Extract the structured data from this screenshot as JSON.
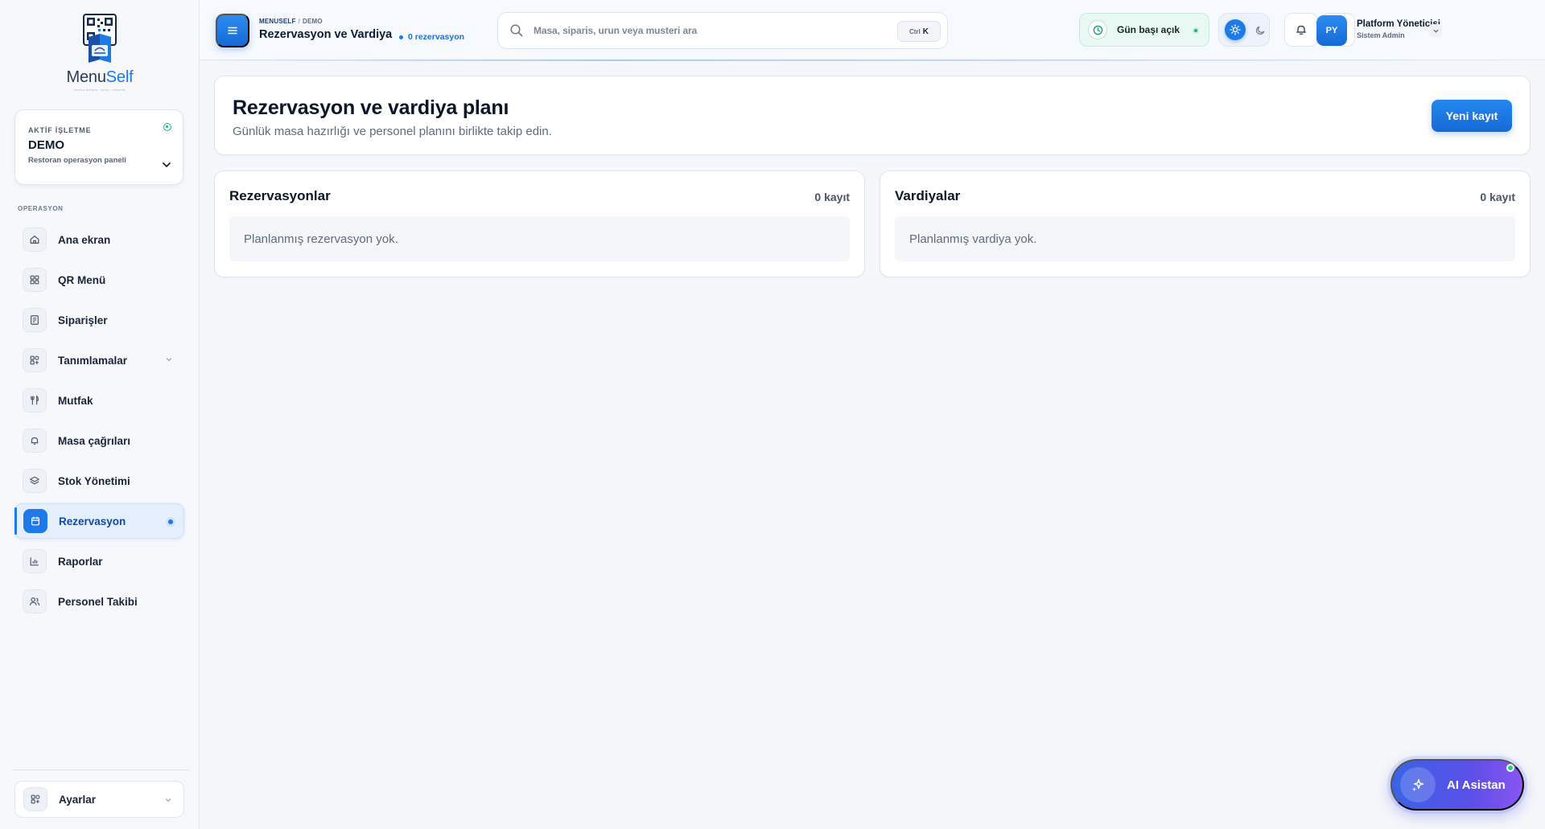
{
  "brand": {
    "logo_part1": "Menu",
    "logo_part2": "Self",
    "tagline": "DİJİTAL SİPARİŞ · MASA · YÖNETİM",
    "accent_color": "#1d7ae8"
  },
  "business": {
    "label": "AKTİF İŞLETME",
    "name": "DEMO",
    "subtitle": "Restoran operasyon paneli"
  },
  "sidebar": {
    "section_label": "OPERASYON",
    "items": [
      {
        "label": "Ana ekran",
        "icon": "home-icon"
      },
      {
        "label": "QR Menü",
        "icon": "grid-icon"
      },
      {
        "label": "Siparişler",
        "icon": "receipt-icon"
      },
      {
        "label": "Tanımlamalar",
        "icon": "widgets-icon",
        "expandable": true
      },
      {
        "label": "Mutfak",
        "icon": "utensils-icon"
      },
      {
        "label": "Masa çağrıları",
        "icon": "bell-icon"
      },
      {
        "label": "Stok Yönetimi",
        "icon": "layers-icon"
      },
      {
        "label": "Rezervasyon",
        "icon": "calendar-icon",
        "active": true
      },
      {
        "label": "Raporlar",
        "icon": "bar-chart-icon"
      },
      {
        "label": "Personel Takibi",
        "icon": "users-icon"
      }
    ],
    "settings_label": "Ayarlar"
  },
  "header": {
    "breadcrumb_root": "MENUSELF",
    "breadcrumb_current": "DEMO",
    "title": "Rezervasyon ve Vardiya",
    "reservation_count": "0 rezervasyon",
    "search_placeholder": "Masa, siparis, urun veya musteri ara",
    "shortcut_mod": "Ctrl",
    "shortcut_key": "K",
    "day_status": "Gün başı açık",
    "user_initials": "PY",
    "user_name": "Platform Yöneticisi",
    "user_role": "Sistem Admin"
  },
  "page": {
    "title": "Rezervasyon ve vardiya planı",
    "subtitle": "Günlük masa hazırlığı ve personel planını birlikte takip edin.",
    "new_button": "Yeni kayıt"
  },
  "panels": {
    "reservations": {
      "title": "Rezervasyonlar",
      "count": "0 kayıt",
      "empty": "Planlanmış rezervasyon yok."
    },
    "shifts": {
      "title": "Vardiyalar",
      "count": "0 kayıt",
      "empty": "Planlanmış vardiya yok."
    }
  },
  "assistant": {
    "label": "AI Asistan"
  }
}
